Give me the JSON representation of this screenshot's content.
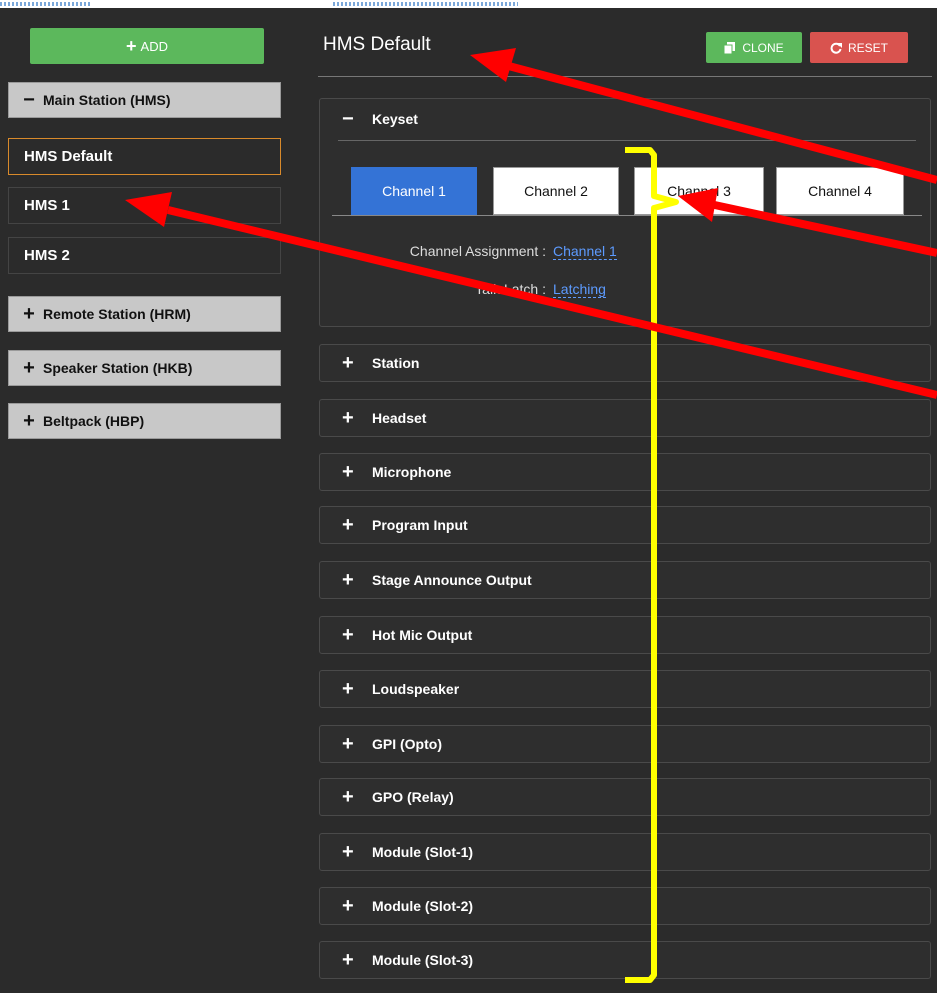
{
  "sidebar": {
    "add_label": "ADD",
    "groups": [
      {
        "symbol": "−",
        "label": "Main Station (HMS)"
      },
      {
        "symbol": "+",
        "label": "Remote Station (HRM)"
      },
      {
        "symbol": "+",
        "label": "Speaker Station (HKB)"
      },
      {
        "symbol": "+",
        "label": "Beltpack (HBP)"
      }
    ],
    "items": [
      {
        "label": "HMS Default",
        "active": true
      },
      {
        "label": "HMS 1"
      },
      {
        "label": "HMS 2"
      }
    ]
  },
  "main": {
    "title": "HMS Default",
    "clone_label": "CLONE",
    "reset_label": "RESET",
    "keyset": {
      "symbol": "−",
      "label": "Keyset",
      "tabs": [
        "Channel 1",
        "Channel 2",
        "Channel 3",
        "Channel 4"
      ],
      "active_tab": "Channel 1",
      "channel_assignment_label": "Channel Assignment :",
      "channel_assignment_value": "Channel 1",
      "talk_latch_label": "Talk Latch :",
      "talk_latch_value": "Latching"
    },
    "sections": [
      "Station",
      "Headset",
      "Microphone",
      "Program Input",
      "Stage Announce Output",
      "Hot Mic Output",
      "Loudspeaker",
      "GPI (Opto)",
      "GPO (Relay)",
      "Module (Slot-1)",
      "Module (Slot-2)",
      "Module (Slot-3)"
    ]
  },
  "colors": {
    "background": "#2b2b2b",
    "green": "#5cb85c",
    "red": "#d9534f",
    "tab_active": "#3473d6",
    "link": "#5d9bff",
    "annotation_arrow": "#ff0000",
    "annotation_bracket": "#ffff00"
  },
  "icons": {
    "clone": "copy-icon",
    "reset": "refresh-icon"
  }
}
